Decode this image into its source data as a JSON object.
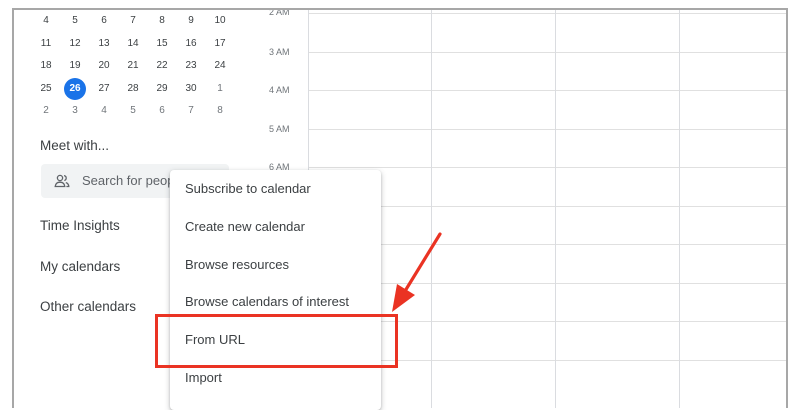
{
  "mini_calendar": {
    "rows": [
      [
        "4",
        "5",
        "6",
        "7",
        "8",
        "9",
        "10"
      ],
      [
        "11",
        "12",
        "13",
        "14",
        "15",
        "16",
        "17"
      ],
      [
        "18",
        "19",
        "20",
        "21",
        "22",
        "23",
        "24"
      ],
      [
        "25",
        "26",
        "27",
        "28",
        "29",
        "30",
        "1"
      ],
      [
        "2",
        "3",
        "4",
        "5",
        "6",
        "7",
        "8"
      ]
    ],
    "today": "26"
  },
  "sidebar": {
    "meet_with": "Meet with...",
    "search_placeholder": "Search for people",
    "time_insights": "Time Insights",
    "my_calendars": "My calendars",
    "other_calendars": "Other calendars"
  },
  "time_labels": [
    "2 AM",
    "3 AM",
    "4 AM",
    "5 AM",
    "6 AM"
  ],
  "menu": {
    "items": [
      "Subscribe to calendar",
      "Create new calendar",
      "Browse resources",
      "Browse calendars of interest",
      "From URL",
      "Import"
    ]
  },
  "colors": {
    "accent": "#1a73e8",
    "annotation": "#ea3323"
  },
  "icons": {
    "people": "people-outline-icon"
  }
}
